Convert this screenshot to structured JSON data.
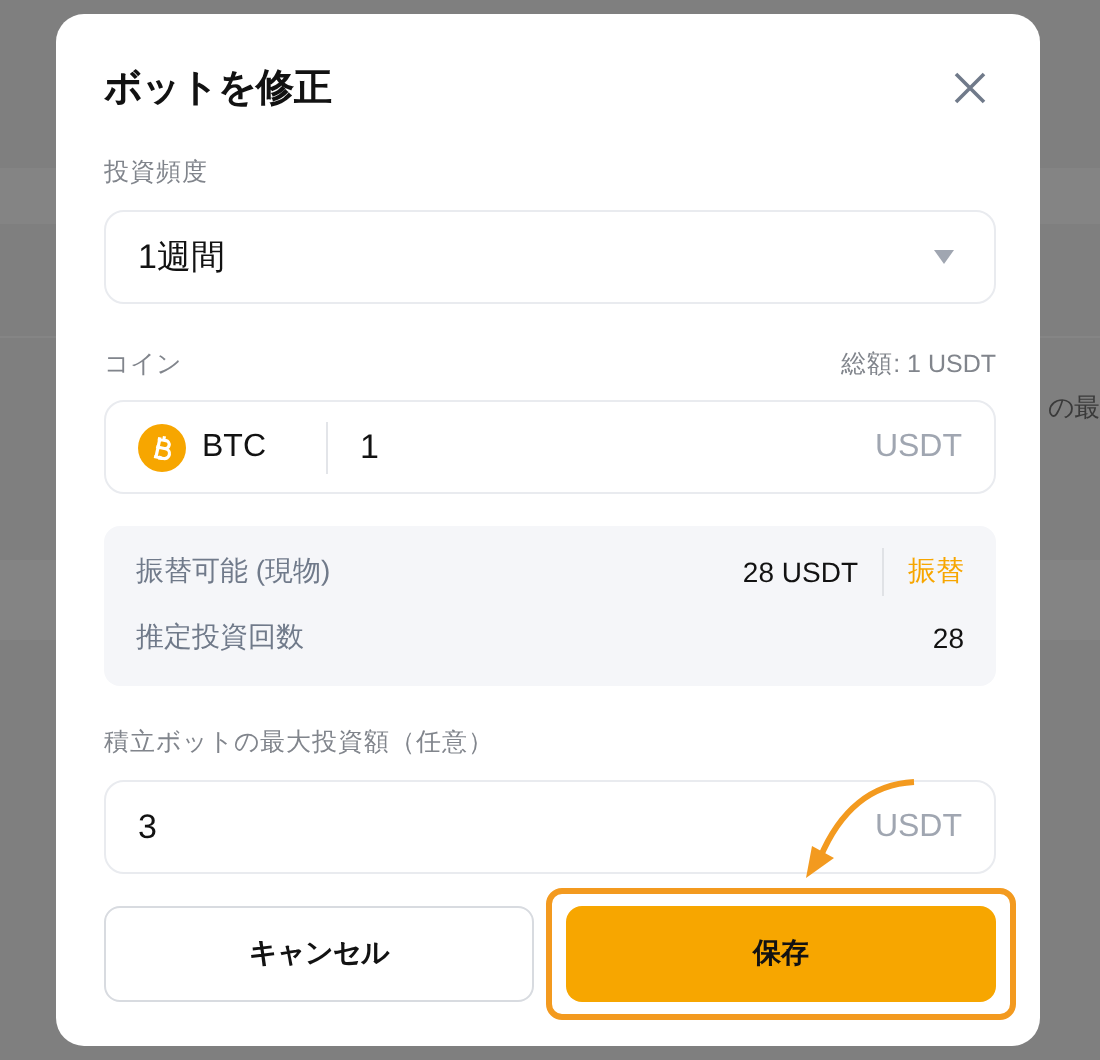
{
  "background": {
    "text_fragment": "の最"
  },
  "dialog": {
    "title": "ボットを修正",
    "frequency": {
      "label": "投資頻度",
      "value": "1週間"
    },
    "coin": {
      "label": "コイン",
      "total": "総額: 1 USDT",
      "asset": "BTC",
      "amount": "1",
      "unit": "USDT"
    },
    "summary": {
      "rows": [
        {
          "label": "振替可能 (現物)",
          "value": "28 USDT",
          "action": "振替"
        },
        {
          "label": "推定投資回数",
          "value": "28"
        }
      ]
    },
    "max_investment": {
      "label": "積立ボットの最大投資額（任意）",
      "value": "3",
      "unit": "USDT"
    },
    "buttons": [
      {
        "label": "キャンセル",
        "kind": "secondary",
        "highlighted": false
      },
      {
        "label": "保存",
        "kind": "primary",
        "highlighted": true
      }
    ]
  }
}
